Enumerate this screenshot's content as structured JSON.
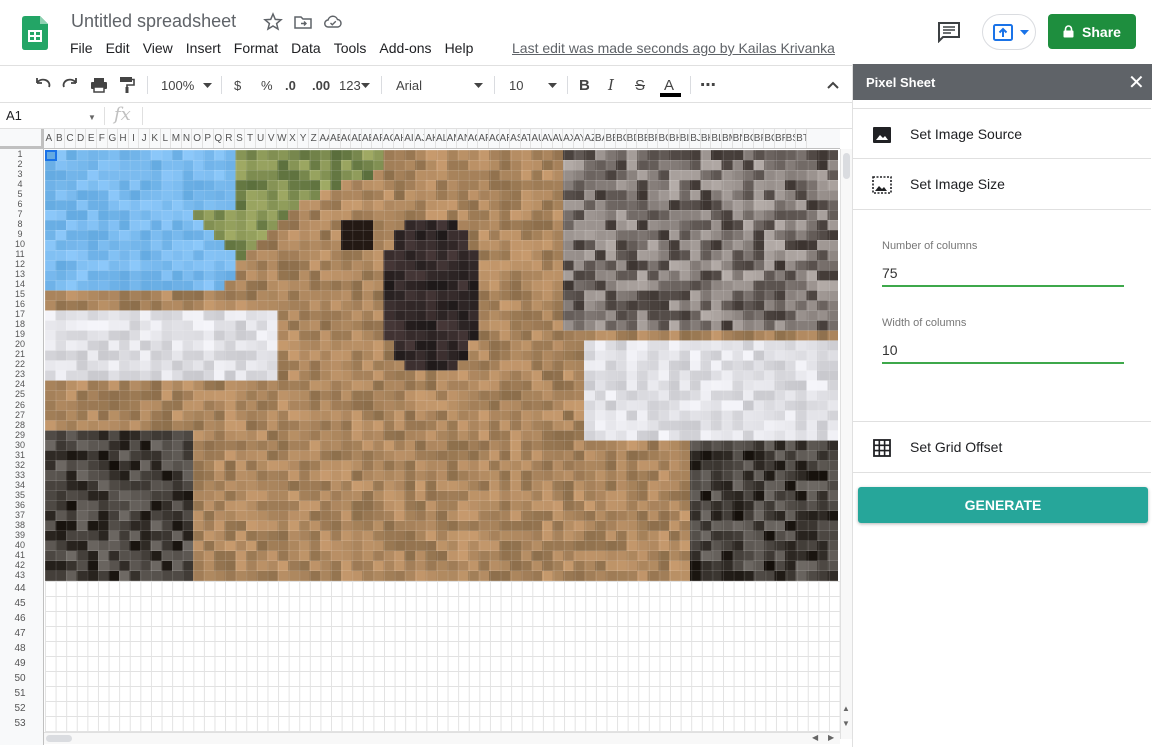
{
  "doc": {
    "title": "Untitled spreadsheet",
    "last_edit": "Last edit was made seconds ago by Kailas Krivanka"
  },
  "menu": [
    "File",
    "Edit",
    "View",
    "Insert",
    "Format",
    "Data",
    "Tools",
    "Add-ons",
    "Help"
  ],
  "share": {
    "label": "Share"
  },
  "toolbar": {
    "zoom": "100%",
    "currency": "$",
    "percent": "%",
    "decrease_decimal": ".0",
    "increase_decimal": ".00",
    "more_formats": "123",
    "font": "Arial",
    "font_size": "10",
    "bold": "B",
    "italic": "I",
    "strikethrough": "S",
    "text_color": "A",
    "more": "⋯"
  },
  "formula_bar": {
    "cell_ref": "A1",
    "fx": "fx"
  },
  "columns": [
    "A",
    "B",
    "C",
    "D",
    "E",
    "F",
    "G",
    "H",
    "I",
    "J",
    "K",
    "L",
    "M",
    "N",
    "O",
    "P",
    "Q",
    "R",
    "S",
    "T",
    "U",
    "V",
    "W",
    "X",
    "Y",
    "Z",
    "AA",
    "AB",
    "AC",
    "AD",
    "AE",
    "AF",
    "AG",
    "AH",
    "AI",
    "AJ",
    "AK",
    "AL",
    "AM",
    "AN",
    "AO",
    "AP",
    "AQ",
    "AR",
    "AS",
    "AT",
    "AU",
    "AV",
    "AW",
    "AX",
    "AY",
    "AZ",
    "BA",
    "BB",
    "BC",
    "BD",
    "BE",
    "BF",
    "BG",
    "BH",
    "BI",
    "BJ",
    "BK",
    "BL",
    "BM",
    "BN",
    "BO",
    "BP",
    "BQ",
    "BR",
    "BS",
    "BT"
  ],
  "rows_pixel": [
    "1",
    "2",
    "3",
    "4",
    "5",
    "6",
    "7",
    "8",
    "9",
    "10",
    "11",
    "12",
    "13",
    "14",
    "15",
    "16",
    "17",
    "18",
    "19",
    "20",
    "21",
    "22",
    "23",
    "24",
    "25",
    "26",
    "27",
    "28",
    "29",
    "30",
    "31",
    "32",
    "33",
    "34",
    "35",
    "36",
    "37",
    "38",
    "39",
    "40",
    "41",
    "42",
    "43"
  ],
  "rows_normal": [
    "44",
    "45",
    "46",
    "47",
    "48",
    "49",
    "50",
    "51",
    "52",
    "53"
  ],
  "sidebar": {
    "title": "Pixel Sheet",
    "close": "✕",
    "set_image_source": "Set Image Source",
    "set_image_size": "Set Image Size",
    "columns_label": "Number of columns",
    "columns_value": "75",
    "width_label": "Width of columns",
    "width_value": "10",
    "set_grid_offset": "Set Grid Offset",
    "generate": "GENERATE"
  }
}
